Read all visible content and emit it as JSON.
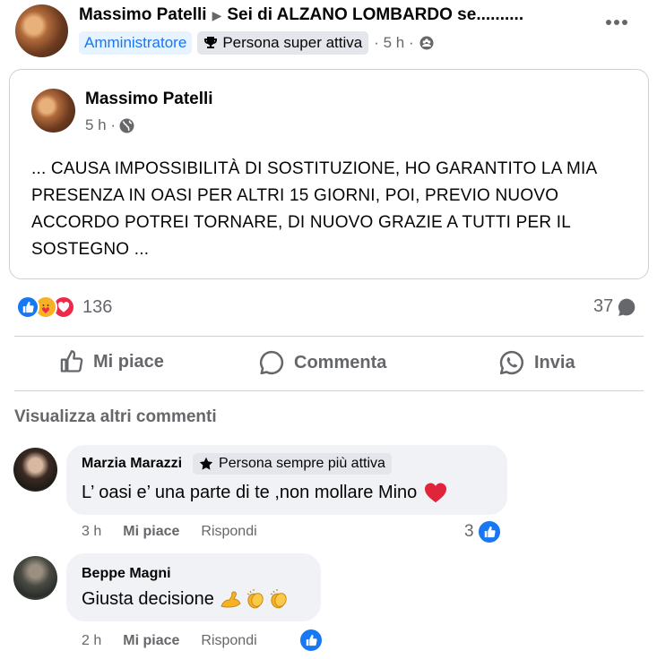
{
  "header": {
    "author": "Massimo Patelli",
    "group": "Sei di ALZANO LOMBARDO se..........",
    "badge_admin": "Amministratore",
    "badge_active": "Persona super attiva",
    "time": "· 5 h ·"
  },
  "shared_post": {
    "author": "Massimo Patelli",
    "time": "5 h ·",
    "text": "... CAUSA IMPOSSIBILITÀ DI SOSTITUZIONE, HO GARANTITO LA MIA PRESENZA IN OASI PER ALTRI 15 GIORNI, POI, PREVIO NUOVO ACCORDO POTREI TORNARE, DI NUOVO GRAZIE A TUTTI PER IL SOSTEGNO ..."
  },
  "stats": {
    "reactions": "136",
    "comments": "37"
  },
  "actions": {
    "like": "Mi piace",
    "comment": "Commenta",
    "share": "Invia"
  },
  "more_comments": "Visualizza altri commenti",
  "comments": [
    {
      "name": "Marzia Marazzi",
      "badge": "Persona sempre più attiva",
      "text": "L’ oasi e’ una parte di te ,non mollare Mino",
      "time": "3 h",
      "like": "Mi piace",
      "reply": "Rispondi",
      "likes": "3"
    },
    {
      "name": "Beppe Magni",
      "text": "Giusta decisione",
      "time": "2 h",
      "like": "Mi piace",
      "reply": "Rispondi"
    }
  ],
  "colors": {
    "accent": "#1877f2",
    "love": "#f02849",
    "care": "#f7b125"
  }
}
